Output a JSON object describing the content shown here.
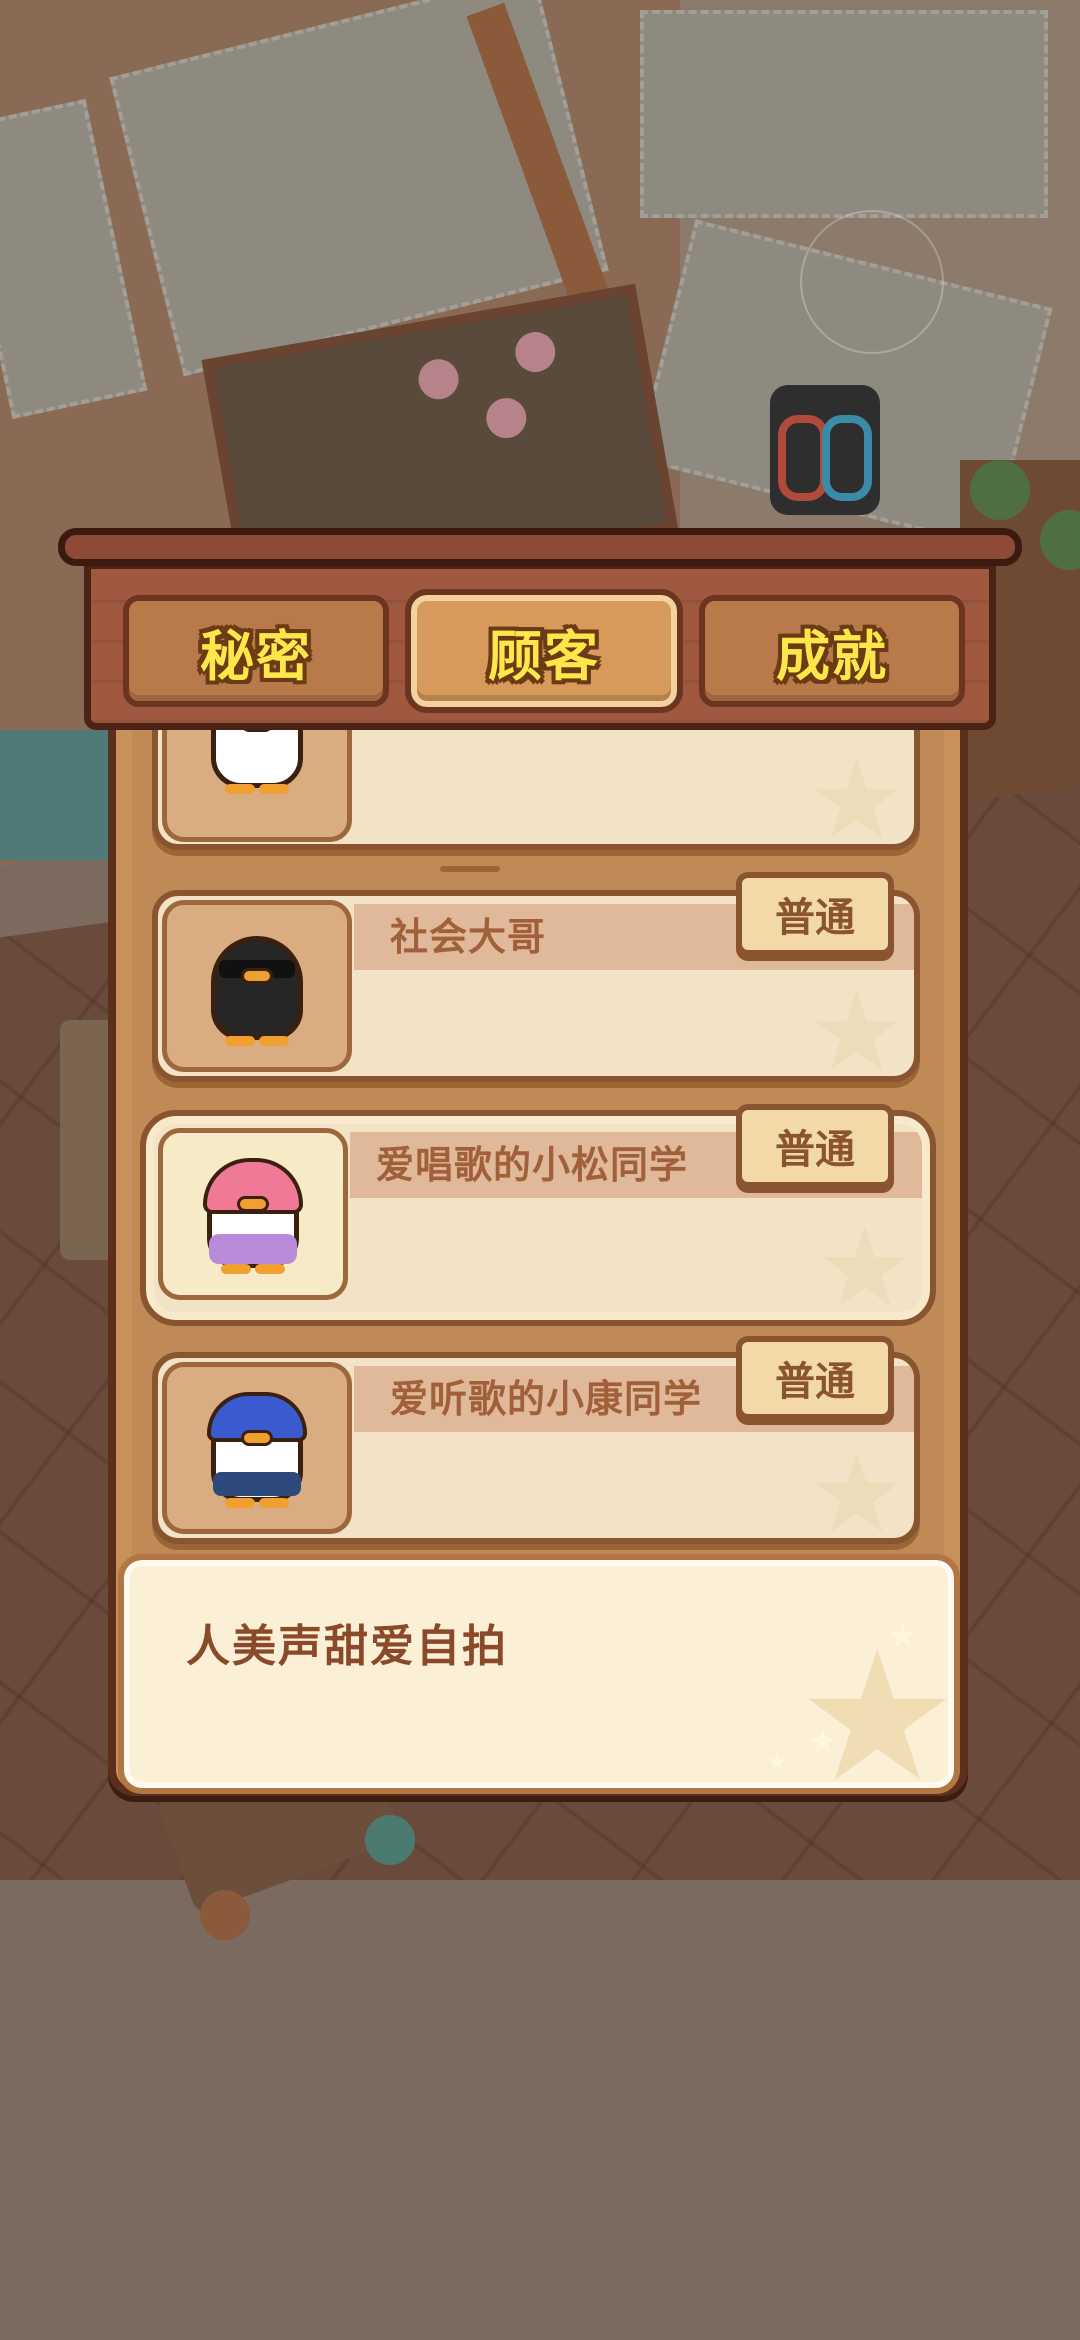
{
  "tabs": [
    {
      "label": "秘密",
      "active": false
    },
    {
      "label": "顾客",
      "active": true
    },
    {
      "label": "成就",
      "active": false
    }
  ],
  "customers": [
    {
      "name": "",
      "rarity": "",
      "avatar": "bride-duck-icon",
      "selected": false
    },
    {
      "name": "社会大哥",
      "rarity": "普通",
      "avatar": "sunglasses-duck-icon",
      "selected": false
    },
    {
      "name": "爱唱歌的小松同学",
      "rarity": "普通",
      "avatar": "pink-hair-duck-icon",
      "selected": true
    },
    {
      "name": "爱听歌的小康同学",
      "rarity": "普通",
      "avatar": "blue-hair-duck-icon",
      "selected": false
    }
  ],
  "description": {
    "text": "人美声甜爱自拍"
  },
  "colors": {
    "tab_text": "#ffe64a",
    "panel_wood": "#c8905a",
    "card_bg": "#f3e3c6",
    "badge_text": "#8a5430"
  }
}
